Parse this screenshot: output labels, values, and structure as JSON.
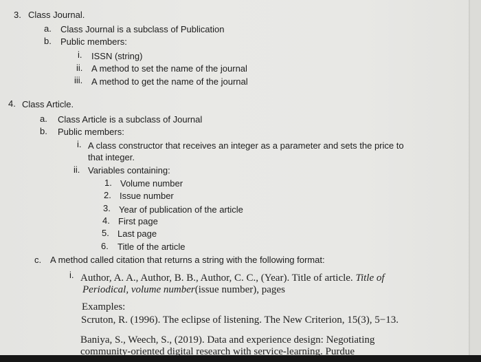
{
  "section3": {
    "number": "3.",
    "title": "Class Journal.",
    "items": [
      {
        "marker": "a.",
        "text": "Class Journal is a subclass of Publication"
      },
      {
        "marker": "b.",
        "text": "Public members:"
      }
    ],
    "members": [
      {
        "marker": "i.",
        "text": "ISSN (string)"
      },
      {
        "marker": "ii.",
        "text": "A method to set the name of the journal"
      },
      {
        "marker": "iii.",
        "text": "A method to get the name of the journal"
      }
    ]
  },
  "section4": {
    "number": "4.",
    "title": "Class Article.",
    "items": [
      {
        "marker": "a.",
        "text": "Class Article is a subclass of Journal"
      },
      {
        "marker": "b.",
        "text": "Public members:"
      }
    ],
    "members": [
      {
        "marker": "i.",
        "text_line1": "A class constructor that receives an integer as a parameter and sets the price to",
        "text_line2": "that integer."
      },
      {
        "marker": "ii.",
        "text": "Variables containing:"
      }
    ],
    "variables": [
      {
        "marker": "1.",
        "text": "Volume number"
      },
      {
        "marker": "2.",
        "text": "Issue number"
      },
      {
        "marker": "3.",
        "text": "Year of publication of the article"
      },
      {
        "marker": "4.",
        "text": "First page"
      },
      {
        "marker": "5.",
        "text": "Last page"
      },
      {
        "marker": "6.",
        "text": "Title of the article"
      }
    ],
    "item_c": {
      "marker": "c.",
      "text": "A method called citation that returns a string with the following format:"
    },
    "format": {
      "marker": "i.",
      "line1_plain": "Author, A. A., Author, B. B., Author, C. C., (Year). Title of article. ",
      "line1_italic": "Title of",
      "line2_italic": "Periodical, volume number",
      "line2_plain": "(issue number), pages"
    },
    "examples_label": "Examples:",
    "example1": "Scruton, R. (1996). The eclipse of listening. The New Criterion, 15(3), 5−13.",
    "example2_line1": "Baniya, S., Weech, S., (2019). Data and experience design: Negotiating",
    "example2_line2": "community-oriented   digital   research   with   service-learning.   Purdue"
  }
}
